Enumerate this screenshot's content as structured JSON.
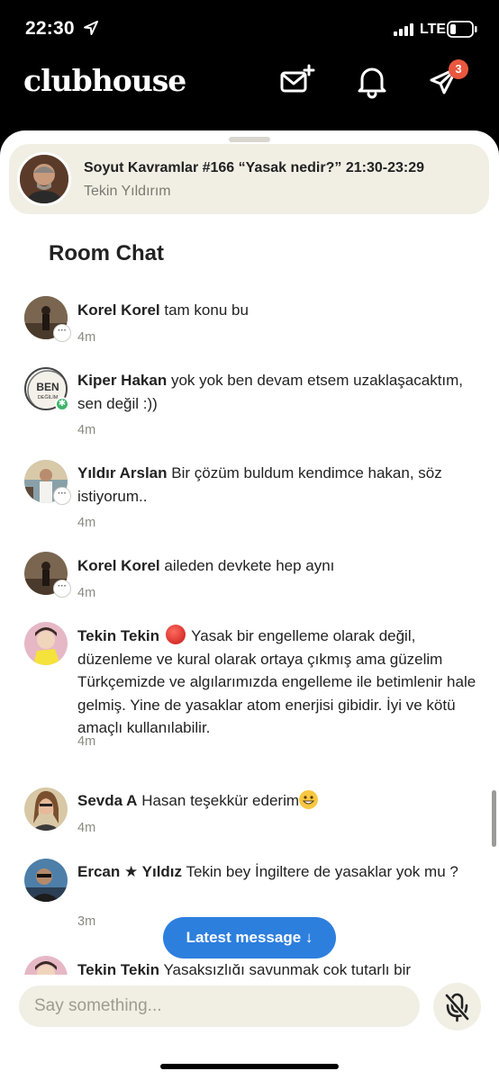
{
  "status_bar": {
    "time": "22:30",
    "network": "LTE"
  },
  "header": {
    "logo": "clubhouse",
    "icons": [
      "mail-sparkle-icon",
      "bell-icon",
      "paper-plane-icon"
    ],
    "notification_badge": "3"
  },
  "room": {
    "title": "Soyut Kavramlar #166 “Yasak nedir?” 21:30-23:29",
    "host": "Tekin Yıldırım"
  },
  "chat_heading": "Room Chat",
  "messages": [
    {
      "name": "Korel Korel",
      "text": "tam konu bu",
      "time": "4m"
    },
    {
      "name": "Kiper Hakan",
      "text": "yok yok ben devam etsem uzaklaşacaktım, sen değil :))",
      "time": "4m",
      "avatar_text": [
        "BEN",
        "DEĞİLİM"
      ]
    },
    {
      "name": "Yıldır Arslan",
      "text": "Bir çözüm buldum kendimce hakan, söz istiyorum..",
      "time": "4m"
    },
    {
      "name": "Korel Korel",
      "text": "aileden devkete hep aynı",
      "time": "4m"
    },
    {
      "name": "Tekin Tekin",
      "text": "Yasak bir engelleme olarak değil, düzenleme ve kural olarak ortaya çıkmış ama güzelim Türkçemizde ve algılarımızda engelleme ile betimlenir hale gelmiş.  Yine de yasaklar atom enerjisi gibidir. İyi ve kötü amaçlı kullanılabilir.",
      "time": "4m"
    },
    {
      "name": "Sevda A",
      "text": "Hasan teşekkür ederim",
      "time": "4m"
    },
    {
      "name": "Ercan ★ Yıldız",
      "text": "Tekin bey İngiltere de yasaklar yok mu ?",
      "time": "3m"
    },
    {
      "name": "Tekin Tekin",
      "text": "Yasaksızlığı savunmak çok tutarlı bir"
    }
  ],
  "latest_button": "Latest message ↓",
  "input": {
    "placeholder": "Say something..."
  }
}
